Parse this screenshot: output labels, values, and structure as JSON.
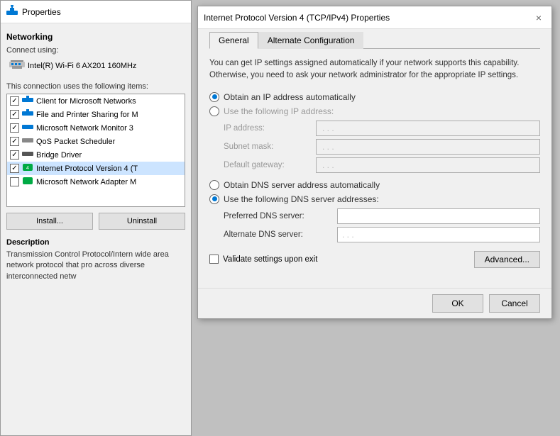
{
  "bg_window": {
    "title": "Properties",
    "section_networking": "Networking",
    "connect_using_label": "Connect using:",
    "adapter_name": "Intel(R) Wi-Fi 6 AX201 160MHz",
    "items_label": "This connection uses the following items:",
    "list_items": [
      {
        "checked": true,
        "label": "Client for Microsoft Networks"
      },
      {
        "checked": true,
        "label": "File and Printer Sharing for M"
      },
      {
        "checked": true,
        "label": "Microsoft Network Monitor 3"
      },
      {
        "checked": true,
        "label": "QoS Packet Scheduler"
      },
      {
        "checked": true,
        "label": "Bridge Driver"
      },
      {
        "checked": true,
        "label": "Internet Protocol Version 4 (T"
      },
      {
        "checked": false,
        "label": "Microsoft Network Adapter M"
      }
    ],
    "install_label": "Install...",
    "uninstall_label": "Uninstall",
    "description_label": "Description",
    "description_text": "Transmission Control Protocol/Intern wide area network protocol that pro across diverse interconnected netw"
  },
  "dialog": {
    "title": "Internet Protocol Version 4 (TCP/IPv4) Properties",
    "close_label": "×",
    "tabs": [
      {
        "label": "General",
        "active": true
      },
      {
        "label": "Alternate Configuration",
        "active": false
      }
    ],
    "info_text": "You can get IP settings assigned automatically if your network supports this capability. Otherwise, you need to ask your network administrator for the appropriate IP settings.",
    "ip_section": {
      "auto_radio_label": "Obtain an IP address automatically",
      "manual_radio_label": "Use the following IP address:",
      "ip_address_label": "IP address:",
      "subnet_mask_label": "Subnet mask:",
      "default_gateway_label": "Default gateway:"
    },
    "dns_section": {
      "auto_radio_label": "Obtain DNS server address automatically",
      "manual_radio_label": "Use the following DNS server addresses:",
      "preferred_label": "Preferred DNS server:",
      "alternate_label": "Alternate DNS server:"
    },
    "validate_label": "Validate settings upon exit",
    "advanced_label": "Advanced...",
    "ok_label": "OK",
    "cancel_label": "Cancel"
  }
}
